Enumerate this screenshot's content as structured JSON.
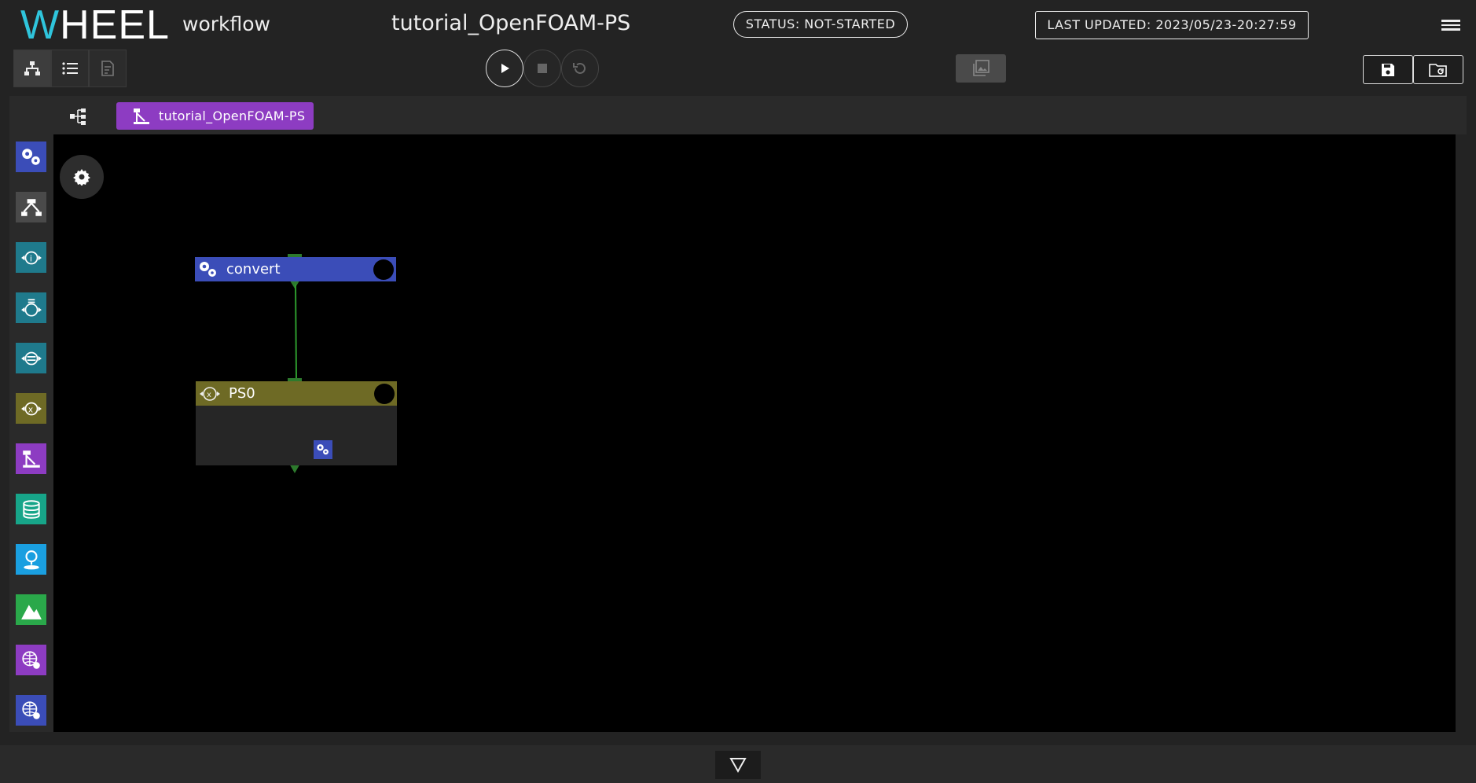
{
  "app": {
    "logo_text": "WHEEL",
    "mode": "workflow",
    "project_name": "tutorial_OpenFOAM-PS",
    "status": "STATUS: NOT-STARTED",
    "last_updated": "LAST UPDATED: 2023/05/23-20:27:59"
  },
  "toolbar": {
    "view_buttons": [
      "graph-view-icon",
      "list-view-icon",
      "text-editor-icon"
    ],
    "run_controls": [
      "play-icon",
      "stop-icon",
      "reset-icon"
    ],
    "viewer_button": "image-viewer-icon",
    "file_buttons": [
      "save-icon",
      "revert-folder-icon"
    ]
  },
  "breadcrumb": {
    "tree_icon": "component-tree-icon",
    "current": "tutorial_OpenFOAM-PS"
  },
  "sidebar": {
    "components": [
      {
        "name": "task",
        "color": "#3b4db8"
      },
      {
        "name": "workflow",
        "color": "#4a4a4a"
      },
      {
        "name": "if",
        "color": "#1f7a8c"
      },
      {
        "name": "for",
        "color": "#1f7a8c"
      },
      {
        "name": "while",
        "color": "#1f7a8c"
      },
      {
        "name": "parameter-study",
        "color": "#6e6a25"
      },
      {
        "name": "foreach",
        "color": "#8d3cc2"
      },
      {
        "name": "storage",
        "color": "#17a589"
      },
      {
        "name": "source",
        "color": "#1a9fe0"
      },
      {
        "name": "viewer",
        "color": "#2aa84a"
      },
      {
        "name": "cloud-task",
        "color": "#8d3cc2"
      },
      {
        "name": "remote-task",
        "color": "#3b4db8"
      }
    ]
  },
  "canvas": {
    "nodes": [
      {
        "id": "convert",
        "label": "convert",
        "type": "task",
        "color": "#3b4db8"
      },
      {
        "id": "PS0",
        "label": "PS0",
        "type": "parameter-study",
        "color": "#6e6a25",
        "children": [
          "task"
        ]
      }
    ],
    "connections": [
      {
        "from": "convert",
        "to": "PS0"
      }
    ]
  }
}
